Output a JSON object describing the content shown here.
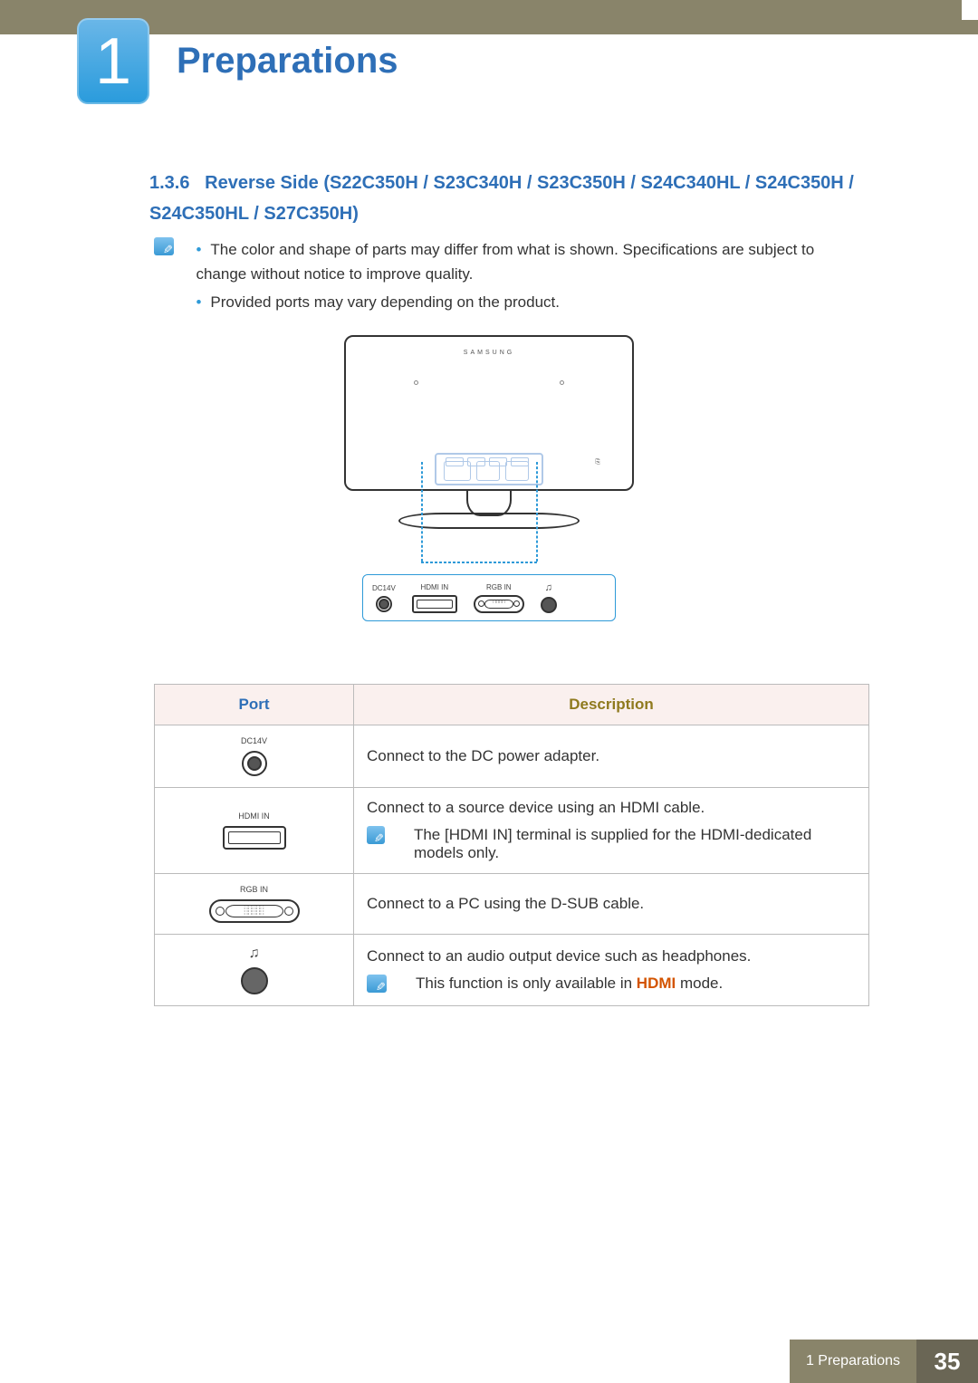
{
  "chapter": {
    "number": "1",
    "title": "Preparations"
  },
  "section": {
    "number": "1.3.6",
    "title": "Reverse Side (S22C350H / S23C340H / S23C350H / S24C340HL / S24C350H / S24C350HL / S27C350H)"
  },
  "notes": [
    "The color and shape of parts may differ from what is shown. Specifications are subject to change without notice to improve quality.",
    "Provided ports may vary depending on the product."
  ],
  "diagram": {
    "brand": "SAMSUNG",
    "ports": {
      "dc14v": "DC14V",
      "hdmi_in": "HDMI IN",
      "rgb_in": "RGB IN",
      "headphone": "♫"
    }
  },
  "table": {
    "headers": {
      "port": "Port",
      "description": "Description"
    },
    "rows": [
      {
        "label": "DC14V",
        "desc": "Connect to the DC power adapter."
      },
      {
        "label": "HDMI IN",
        "desc": "Connect to a source device using an HDMI cable.",
        "subnote": "The [HDMI IN] terminal is supplied for the HDMI-dedicated models only."
      },
      {
        "label": "RGB IN",
        "desc": "Connect to a PC using the D-SUB cable."
      },
      {
        "label": "headphone",
        "desc": "Connect to an audio output device such as headphones.",
        "subnote_prefix": "This function is only available in ",
        "subnote_bold": "HDMI",
        "subnote_suffix": " mode."
      }
    ]
  },
  "footer": {
    "chapter_ref": "1 Preparations",
    "page": "35"
  }
}
